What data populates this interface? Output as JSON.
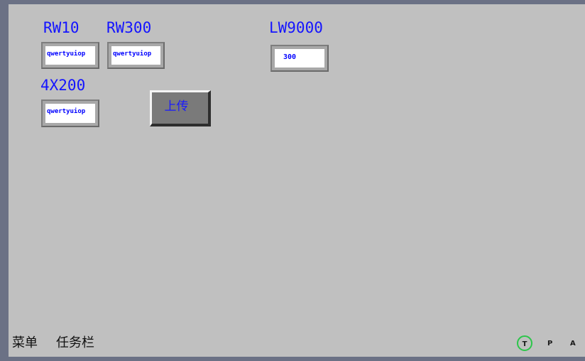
{
  "labels": {
    "rw10": "RW10",
    "rw300": "RW300",
    "lw9000": "LW9000",
    "x4_200": "4X200"
  },
  "fields": {
    "rw10_value": "qwertyuiop",
    "rw300_value": "qwertyuiop",
    "lw9000_value": "300",
    "x4_200_value": "qwertyuiop"
  },
  "buttons": {
    "upload_label": "上传"
  },
  "taskbar": {
    "menu_label": "菜单",
    "taskbar_label": "任务栏"
  },
  "status": {
    "t": "T",
    "p": "P",
    "a": "A",
    "t_ring_color": "#2cc64a"
  },
  "colors": {
    "label_blue": "#1414ff",
    "screen_bg": "#c0c0c0",
    "frame_bg": "#6b7185"
  }
}
